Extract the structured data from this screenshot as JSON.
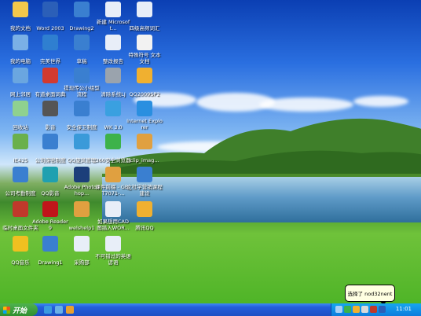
{
  "desktop": {
    "icons": [
      {
        "label": "我的文档",
        "icon": "folder-icon",
        "color": "#f3c84b"
      },
      {
        "label": "Word 2003",
        "icon": "word-icon",
        "color": "#2b5fb8"
      },
      {
        "label": "Drawing2",
        "icon": "drawing-icon",
        "color": "#3a7fd0"
      },
      {
        "label": "新建 Microsoft...",
        "icon": "document-icon",
        "color": "#e8eef8"
      },
      {
        "label": "四级高频词汇",
        "icon": "document-icon",
        "color": "#e8eef8"
      },
      {
        "label": "我的电脑",
        "icon": "computer-icon",
        "color": "#7ab0e6"
      },
      {
        "label": "完美世界",
        "icon": "game-icon",
        "color": "#2f7fd0"
      },
      {
        "label": "草稿",
        "icon": "drawing-icon",
        "color": "#3a7fd0"
      },
      {
        "label": "整改报告",
        "icon": "document-icon",
        "color": "#e8eef8"
      },
      {
        "label": "特殊符号 文本文档",
        "icon": "text-file-icon",
        "color": "#f2f2f2"
      },
      {
        "label": "网上邻居",
        "icon": "network-icon",
        "color": "#6aa6e0"
      },
      {
        "label": "有道桌面词典",
        "icon": "dictionary-icon",
        "color": "#d23a2f"
      },
      {
        "label": "提现传公小组型流程",
        "icon": "drawing-icon",
        "color": "#3a7fd0"
      },
      {
        "label": "清除系统LJ",
        "icon": "batch-file-icon",
        "color": "#9aa3ad"
      },
      {
        "label": "QQ2009SP2",
        "icon": "qq-icon",
        "color": "#f0b030"
      },
      {
        "label": "回收站",
        "icon": "recycle-bin-icon",
        "color": "#8fd18f"
      },
      {
        "label": "影音",
        "icon": "media-icon",
        "color": "#555"
      },
      {
        "label": "安全保卫制度",
        "icon": "drawing-icon",
        "color": "#3a7fd0"
      },
      {
        "label": "WK 3.0",
        "icon": "app-icon",
        "color": "#3aa0e0"
      },
      {
        "label": "Internet Explorer",
        "icon": "ie-icon",
        "color": "#2a8fe0"
      },
      {
        "label": "IE425",
        "icon": "archive-icon",
        "color": "#6ab04c"
      },
      {
        "label": "公司保密制度",
        "icon": "drawing-icon",
        "color": "#3a7fd0"
      },
      {
        "label": "QQ旋风管理",
        "icon": "qq-whirlwind-icon",
        "color": "#3a9ad9"
      },
      {
        "label": "360安全浏览器",
        "icon": "browser-360-icon",
        "color": "#3db24a"
      },
      {
        "label": "clip_imag...",
        "icon": "image-icon",
        "color": "#e0a040"
      },
      {
        "label": "公司考勤制度",
        "icon": "drawing-icon",
        "color": "#3a7fd0"
      },
      {
        "label": "QQ影音",
        "icon": "qq-player-icon",
        "color": "#1fa0b0"
      },
      {
        "label": "Adobe Photoshop...",
        "icon": "photoshop-icon",
        "color": "#1c3f7a"
      },
      {
        "label": "课件前缀 - GB_T7071-...",
        "icon": "image-icon",
        "color": "#e0a040"
      },
      {
        "label": "文社学营销课程建设",
        "icon": "drawing-icon",
        "color": "#3a7fd0"
      },
      {
        "label": "临时桌面文件夹",
        "icon": "archive-icon",
        "color": "#c0392b"
      },
      {
        "label": "Adobe Reader 9",
        "icon": "pdf-icon",
        "color": "#c0151a"
      },
      {
        "label": "welshelp1",
        "icon": "text-file-icon",
        "color": "#e0a040"
      },
      {
        "label": "如果想用CAD 图插入WOR...",
        "icon": "document-icon",
        "color": "#e8eef8"
      },
      {
        "label": "腾讯QQ",
        "icon": "qq-icon",
        "color": "#f0b030"
      },
      {
        "label": "QQ音乐",
        "icon": "qq-music-icon",
        "color": "#f0c020"
      },
      {
        "label": "Drawing1",
        "icon": "drawing-icon",
        "color": "#3a7fd0"
      },
      {
        "label": "采购部",
        "icon": "document-icon",
        "color": "#e8eef8"
      },
      {
        "label": "不可错过的英语谚语",
        "icon": "document-icon",
        "color": "#e8eef8"
      }
    ]
  },
  "taskbar": {
    "start_label": "开始",
    "clock": "11:01",
    "balloon_text": "选择了 nod32nent"
  }
}
